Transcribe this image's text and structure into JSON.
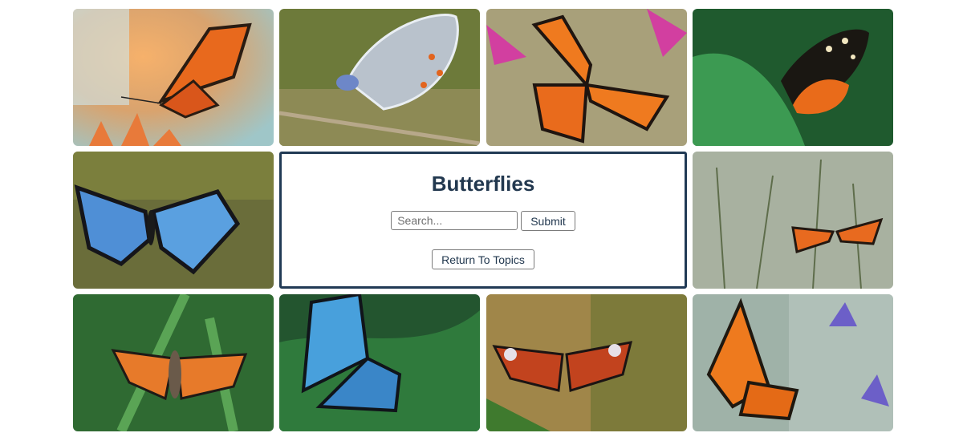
{
  "panel": {
    "title": "Butterflies",
    "search_placeholder": "Search...",
    "submit_label": "Submit",
    "return_label": "Return To Topics"
  },
  "gallery": {
    "images": [
      {
        "name": "monarch-butterfly-image"
      },
      {
        "name": "blue-gossamer-butterfly-image"
      },
      {
        "name": "orange-butterfly-on-flower-image"
      },
      {
        "name": "tiger-longwing-butterfly-image"
      },
      {
        "name": "blue-morpho-on-bark-image"
      },
      {
        "name": "orange-butterfly-in-meadow-image"
      },
      {
        "name": "tortoiseshell-on-grass-image"
      },
      {
        "name": "blue-morpho-on-leaves-image"
      },
      {
        "name": "peacock-butterfly-image"
      },
      {
        "name": "tortoiseshell-on-lavender-image"
      }
    ]
  }
}
